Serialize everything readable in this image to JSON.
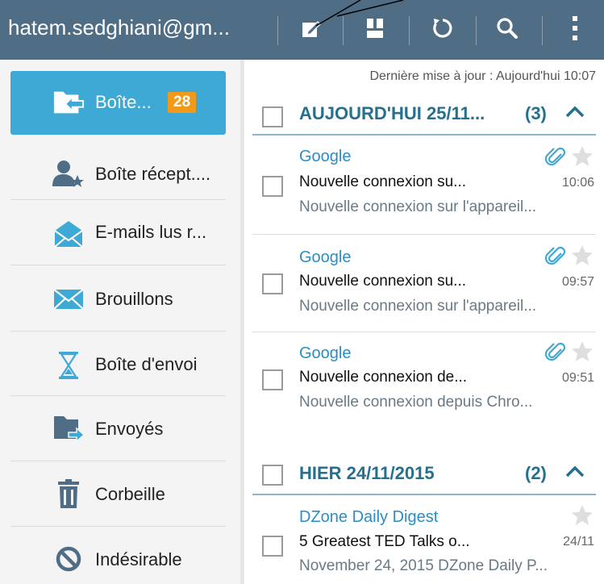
{
  "header": {
    "account": "hatem.sedghiani@gm...",
    "icons": [
      "compose-icon",
      "split-view-icon",
      "refresh-icon",
      "search-icon",
      "more-icon"
    ]
  },
  "sidebar": {
    "items": [
      {
        "label": "Boîte...",
        "badge": "28",
        "icon": "inbox-folder-icon",
        "active": true
      },
      {
        "label": "Boîte récept....",
        "icon": "vip-inbox-icon"
      },
      {
        "label": "E-mails lus r...",
        "icon": "read-mail-icon"
      },
      {
        "label": "Brouillons",
        "icon": "drafts-icon"
      },
      {
        "label": "Boîte d'envoi",
        "icon": "outbox-hourglass-icon"
      },
      {
        "label": "Envoyés",
        "icon": "sent-folder-icon"
      },
      {
        "label": "Corbeille",
        "icon": "trash-icon"
      },
      {
        "label": "Indésirable",
        "icon": "spam-icon"
      }
    ]
  },
  "main": {
    "last_update": "Dernière mise à jour : Aujourd'hui 10:07",
    "groups": [
      {
        "title": "AUJOURD'HUI 25/11...",
        "count": "(3)",
        "mails": [
          {
            "sender": "Google",
            "subject": "Nouvelle connexion su...",
            "time": "10:06",
            "preview": "Nouvelle connexion sur l'appareil..."
          },
          {
            "sender": "Google",
            "subject": "Nouvelle connexion su...",
            "time": "09:57",
            "preview": "Nouvelle connexion sur l'appareil..."
          },
          {
            "sender": "Google",
            "subject": "Nouvelle connexion de...",
            "time": "09:51",
            "preview": "Nouvelle connexion depuis Chro..."
          }
        ]
      },
      {
        "title": "HIER  24/11/2015",
        "count": "(2)",
        "mails": [
          {
            "sender": "DZone Daily Digest",
            "subject": "5 Greatest TED Talks o...",
            "time": "24/11",
            "preview": "November 24, 2015 DZone Daily P..."
          }
        ]
      }
    ]
  },
  "colors": {
    "topbar": "#4f6d85",
    "active_item": "#3fa9d6",
    "badge": "#f29a18",
    "group_header": "#25708f",
    "sender": "#2a8ec4"
  }
}
